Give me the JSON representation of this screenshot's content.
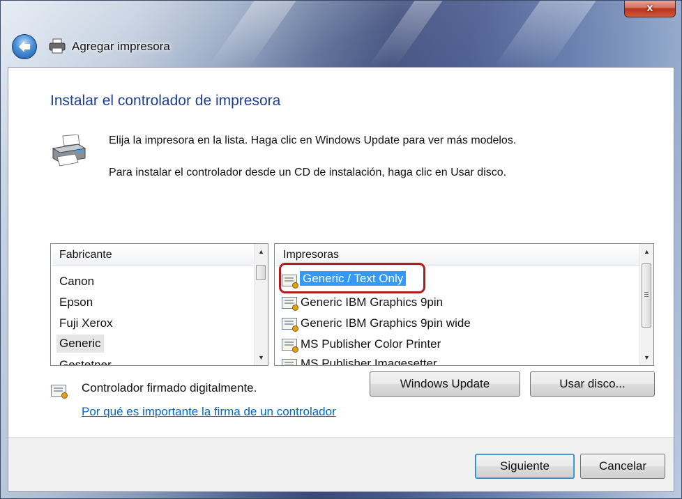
{
  "window": {
    "title": "Agregar impresora",
    "close_label": "x"
  },
  "page": {
    "heading": "Instalar el controlador de impresora",
    "line1": "Elija la impresora en la lista. Haga clic en Windows Update para ver más modelos.",
    "line2": "Para instalar el controlador desde un CD de instalación, haga clic en Usar disco."
  },
  "manufacturers": {
    "header": "Fabricante",
    "items": [
      "Canon",
      "Epson",
      "Fuji Xerox",
      "Generic",
      "Gestetner"
    ],
    "selected": "Generic"
  },
  "printers": {
    "header": "Impresoras",
    "items": [
      "Generic / Text Only",
      "Generic IBM Graphics 9pin",
      "Generic IBM Graphics 9pin wide",
      "MS Publisher Color Printer",
      "MS Publisher Imagesetter"
    ],
    "selected": "Generic / Text Only"
  },
  "signature": {
    "status": "Controlador firmado digitalmente.",
    "link": "Por qué es importante la firma de un controlador"
  },
  "buttons": {
    "windows_update": "Windows Update",
    "use_disk": "Usar disco...",
    "next": "Siguiente",
    "cancel": "Cancelar"
  },
  "colors": {
    "heading": "#1e3f8e",
    "selection": "#3399ff",
    "link": "#0066cc",
    "highlight_ring": "#b31b1b"
  }
}
